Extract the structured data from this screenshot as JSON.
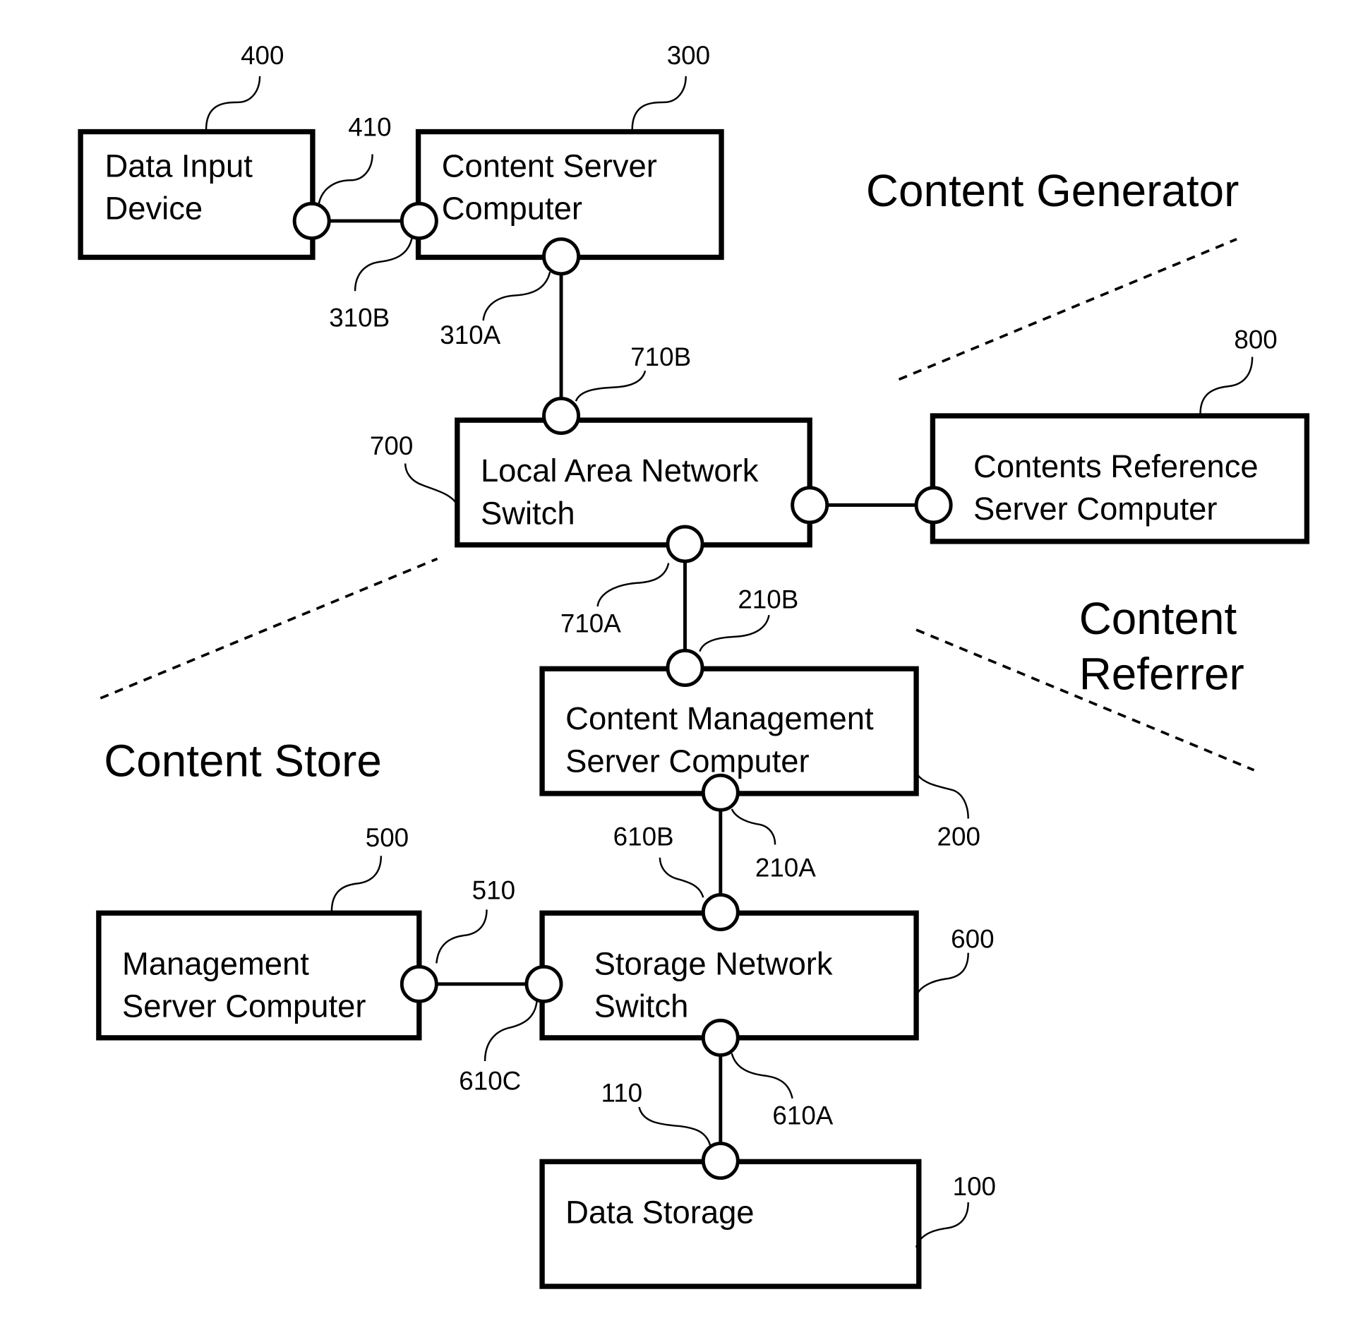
{
  "diagram": {
    "boxes": {
      "data_input": {
        "line1": "Data Input",
        "line2": "Device",
        "ref": "400"
      },
      "content_server": {
        "line1": "Content Server",
        "line2": "Computer",
        "ref": "300"
      },
      "lan_switch": {
        "line1": "Local Area Network",
        "line2": "Switch",
        "ref": "700"
      },
      "contents_reference": {
        "line1": "Contents Reference",
        "line2": "Server Computer",
        "ref": "800"
      },
      "content_management": {
        "line1": "Content Management",
        "line2": "Server Computer",
        "ref": "200"
      },
      "management_server": {
        "line1": "Management",
        "line2": "Server Computer",
        "ref": "500"
      },
      "storage_switch": {
        "line1": "Storage Network",
        "line2": "Switch",
        "ref": "600"
      },
      "data_storage": {
        "line1": "Data Storage",
        "ref": "100"
      }
    },
    "ports": {
      "p410": "410",
      "p310B": "310B",
      "p310A": "310A",
      "p710B": "710B",
      "p710A": "710A",
      "p210B": "210B",
      "p210A": "210A",
      "p610B": "610B",
      "p510": "510",
      "p610C": "610C",
      "p610A": "610A",
      "p110": "110"
    },
    "regions": {
      "content_generator": "Content Generator",
      "content_referrer_1": "Content",
      "content_referrer_2": "Referrer",
      "content_store": "Content Store"
    }
  }
}
